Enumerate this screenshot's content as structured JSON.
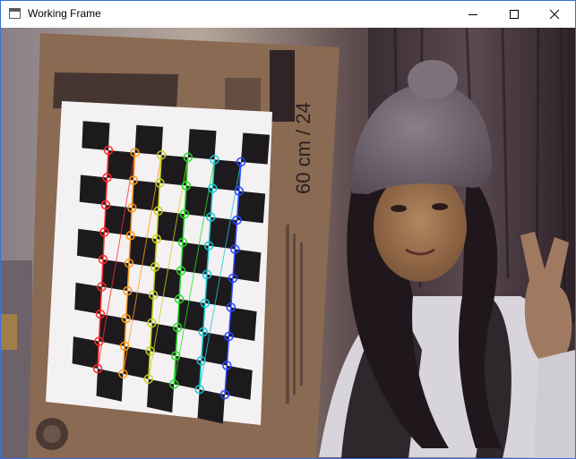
{
  "window": {
    "title": "Working Frame",
    "controls": [
      "minimize",
      "maximize",
      "close"
    ]
  },
  "frame": {
    "content": "webcam image of a person holding a checkerboard calibration target with detected corners",
    "board_label": "60 cm / 24",
    "checkerboard": {
      "columns": 6,
      "rows": 9
    },
    "corner_colors": [
      "#ff2a2a",
      "#ff9a1a",
      "#c8d21e",
      "#2adc2a",
      "#1ec8d2",
      "#2a46ff"
    ]
  },
  "colors": {
    "window_border": "#3a6fd8",
    "titlebar": "#ffffff"
  }
}
